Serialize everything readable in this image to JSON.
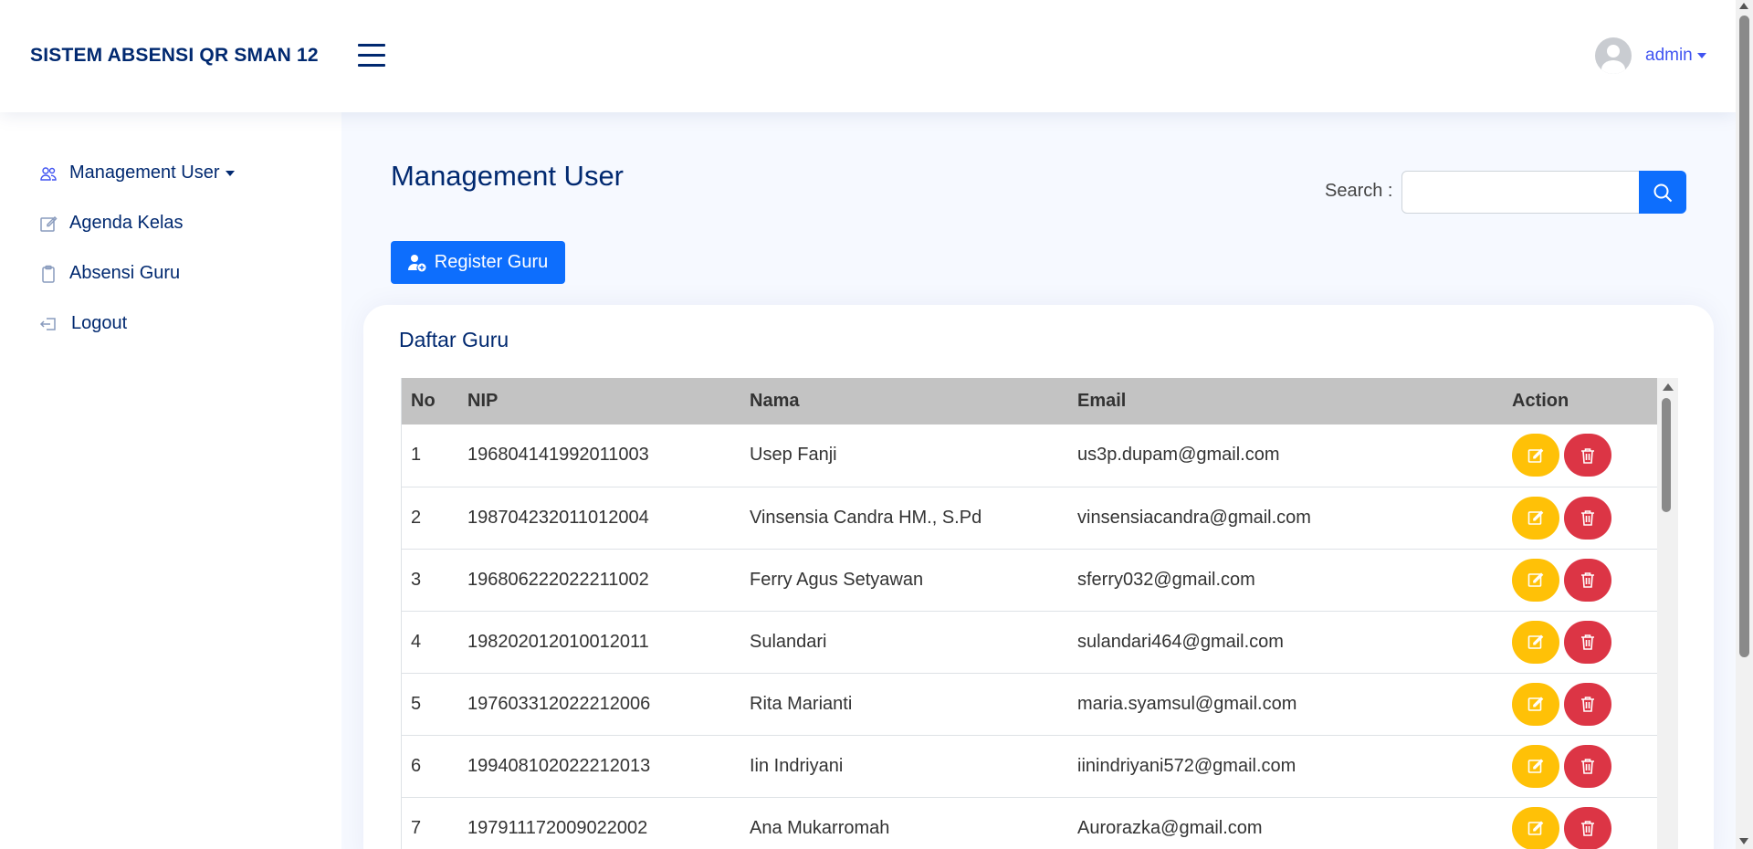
{
  "header": {
    "brand": "SISTEM ABSENSI QR SMAN 12",
    "username": "admin"
  },
  "sidebar": {
    "items": [
      {
        "label": "Management User",
        "icon": "people-icon",
        "has_caret": true
      },
      {
        "label": "Agenda Kelas",
        "icon": "pencil-square-icon"
      },
      {
        "label": "Absensi Guru",
        "icon": "clipboard-icon"
      },
      {
        "label": "Logout",
        "icon": "box-arrow-in-left-icon"
      }
    ]
  },
  "main": {
    "title": "Management User",
    "search_label": "Search :",
    "search_value": "",
    "register_label": "Register Guru",
    "card_title": "Daftar Guru"
  },
  "table": {
    "columns": [
      "No",
      "NIP",
      "Nama",
      "Email",
      "Action"
    ],
    "rows": [
      [
        "1",
        "196804141992011003",
        "Usep Fanji",
        "us3p.dupam@gmail.com"
      ],
      [
        "2",
        "198704232011012004",
        "Vinsensia Candra HM., S.Pd",
        "vinsensiacandra@gmail.com"
      ],
      [
        "3",
        "196806222022211002",
        "Ferry Agus Setyawan",
        "sferry032@gmail.com"
      ],
      [
        "4",
        "198202012010012011",
        "Sulandari",
        "sulandari464@gmail.com"
      ],
      [
        "5",
        "197603312022212006",
        "Rita Marianti",
        "maria.syamsul@gmail.com"
      ],
      [
        "6",
        "199408102022212013",
        "Iin Indriyani",
        "iinindriyani572@gmail.com"
      ],
      [
        "7",
        "197911172009022002",
        "Ana Mukarromah",
        "Aurorazka@gmail.com"
      ]
    ]
  },
  "colors": {
    "primary": "#0d6efd",
    "navy": "#012970",
    "edit": "#ffc107",
    "delete": "#dc3545",
    "table_header": "#c3c3c3"
  }
}
